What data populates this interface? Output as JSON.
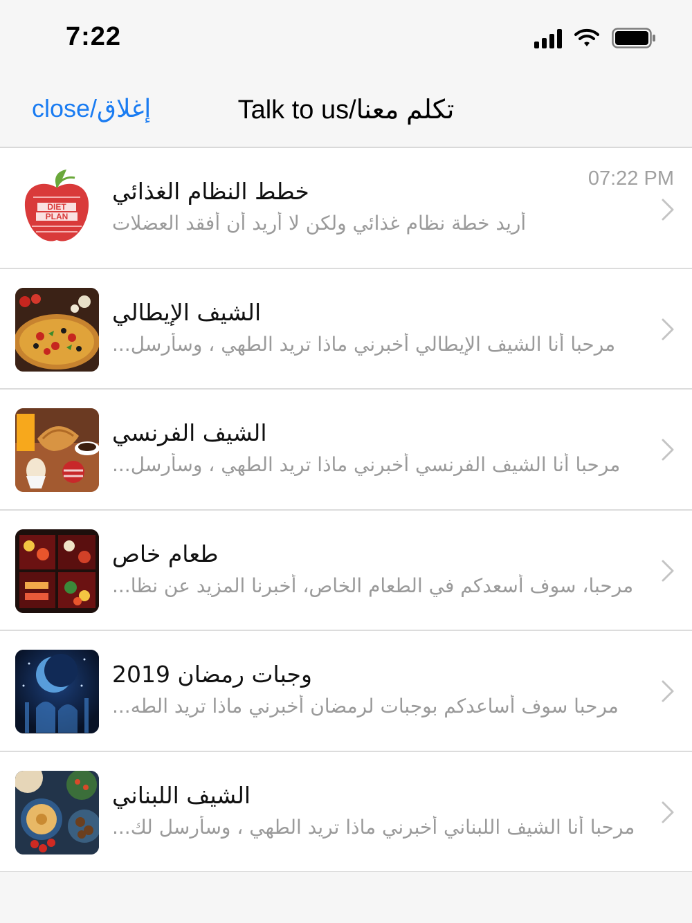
{
  "status_bar": {
    "time": "7:22"
  },
  "nav": {
    "close_label": "close/إغلاق",
    "title": "Talk to us/تكلم معنا"
  },
  "conversations": [
    {
      "title": "خطط النظام الغذائي",
      "preview": "أريد خطة نظام غذائي ولكن لا أريد أن أفقد العضلات",
      "time": "07:22 PM",
      "thumb": "diet-plan-apple"
    },
    {
      "title": "الشيف الإيطالي",
      "preview": "مرحبا أنا الشيف الإيطالي أخبرني ماذا تريد الطهي ، وسأرسل...",
      "time": "",
      "thumb": "pizza"
    },
    {
      "title": "الشيف الفرنسي",
      "preview": "مرحبا أنا الشيف الفرنسي أخبرني ماذا تريد الطهي ، وسأرسل...",
      "time": "",
      "thumb": "french-breakfast"
    },
    {
      "title": "طعام خاص",
      "preview": "مرحبا، سوف أسعدكم في الطعام الخاص، أخبرنا المزيد عن نظا...",
      "time": "",
      "thumb": "bento-box"
    },
    {
      "title": "وجبات رمضان 2019",
      "preview": "مرحبا سوف أساعدكم بوجبات لرمضان أخبرني ماذا تريد الطه...",
      "time": "",
      "thumb": "ramadan-crescent"
    },
    {
      "title": "الشيف اللبناني",
      "preview": "مرحبا أنا الشيف اللبناني أخبرني ماذا تريد الطهي ، وسأرسل لك...",
      "time": "",
      "thumb": "lebanese-mezze"
    }
  ],
  "colors": {
    "accent": "#1a7cf2",
    "secondary_text": "#9a9a9a"
  }
}
